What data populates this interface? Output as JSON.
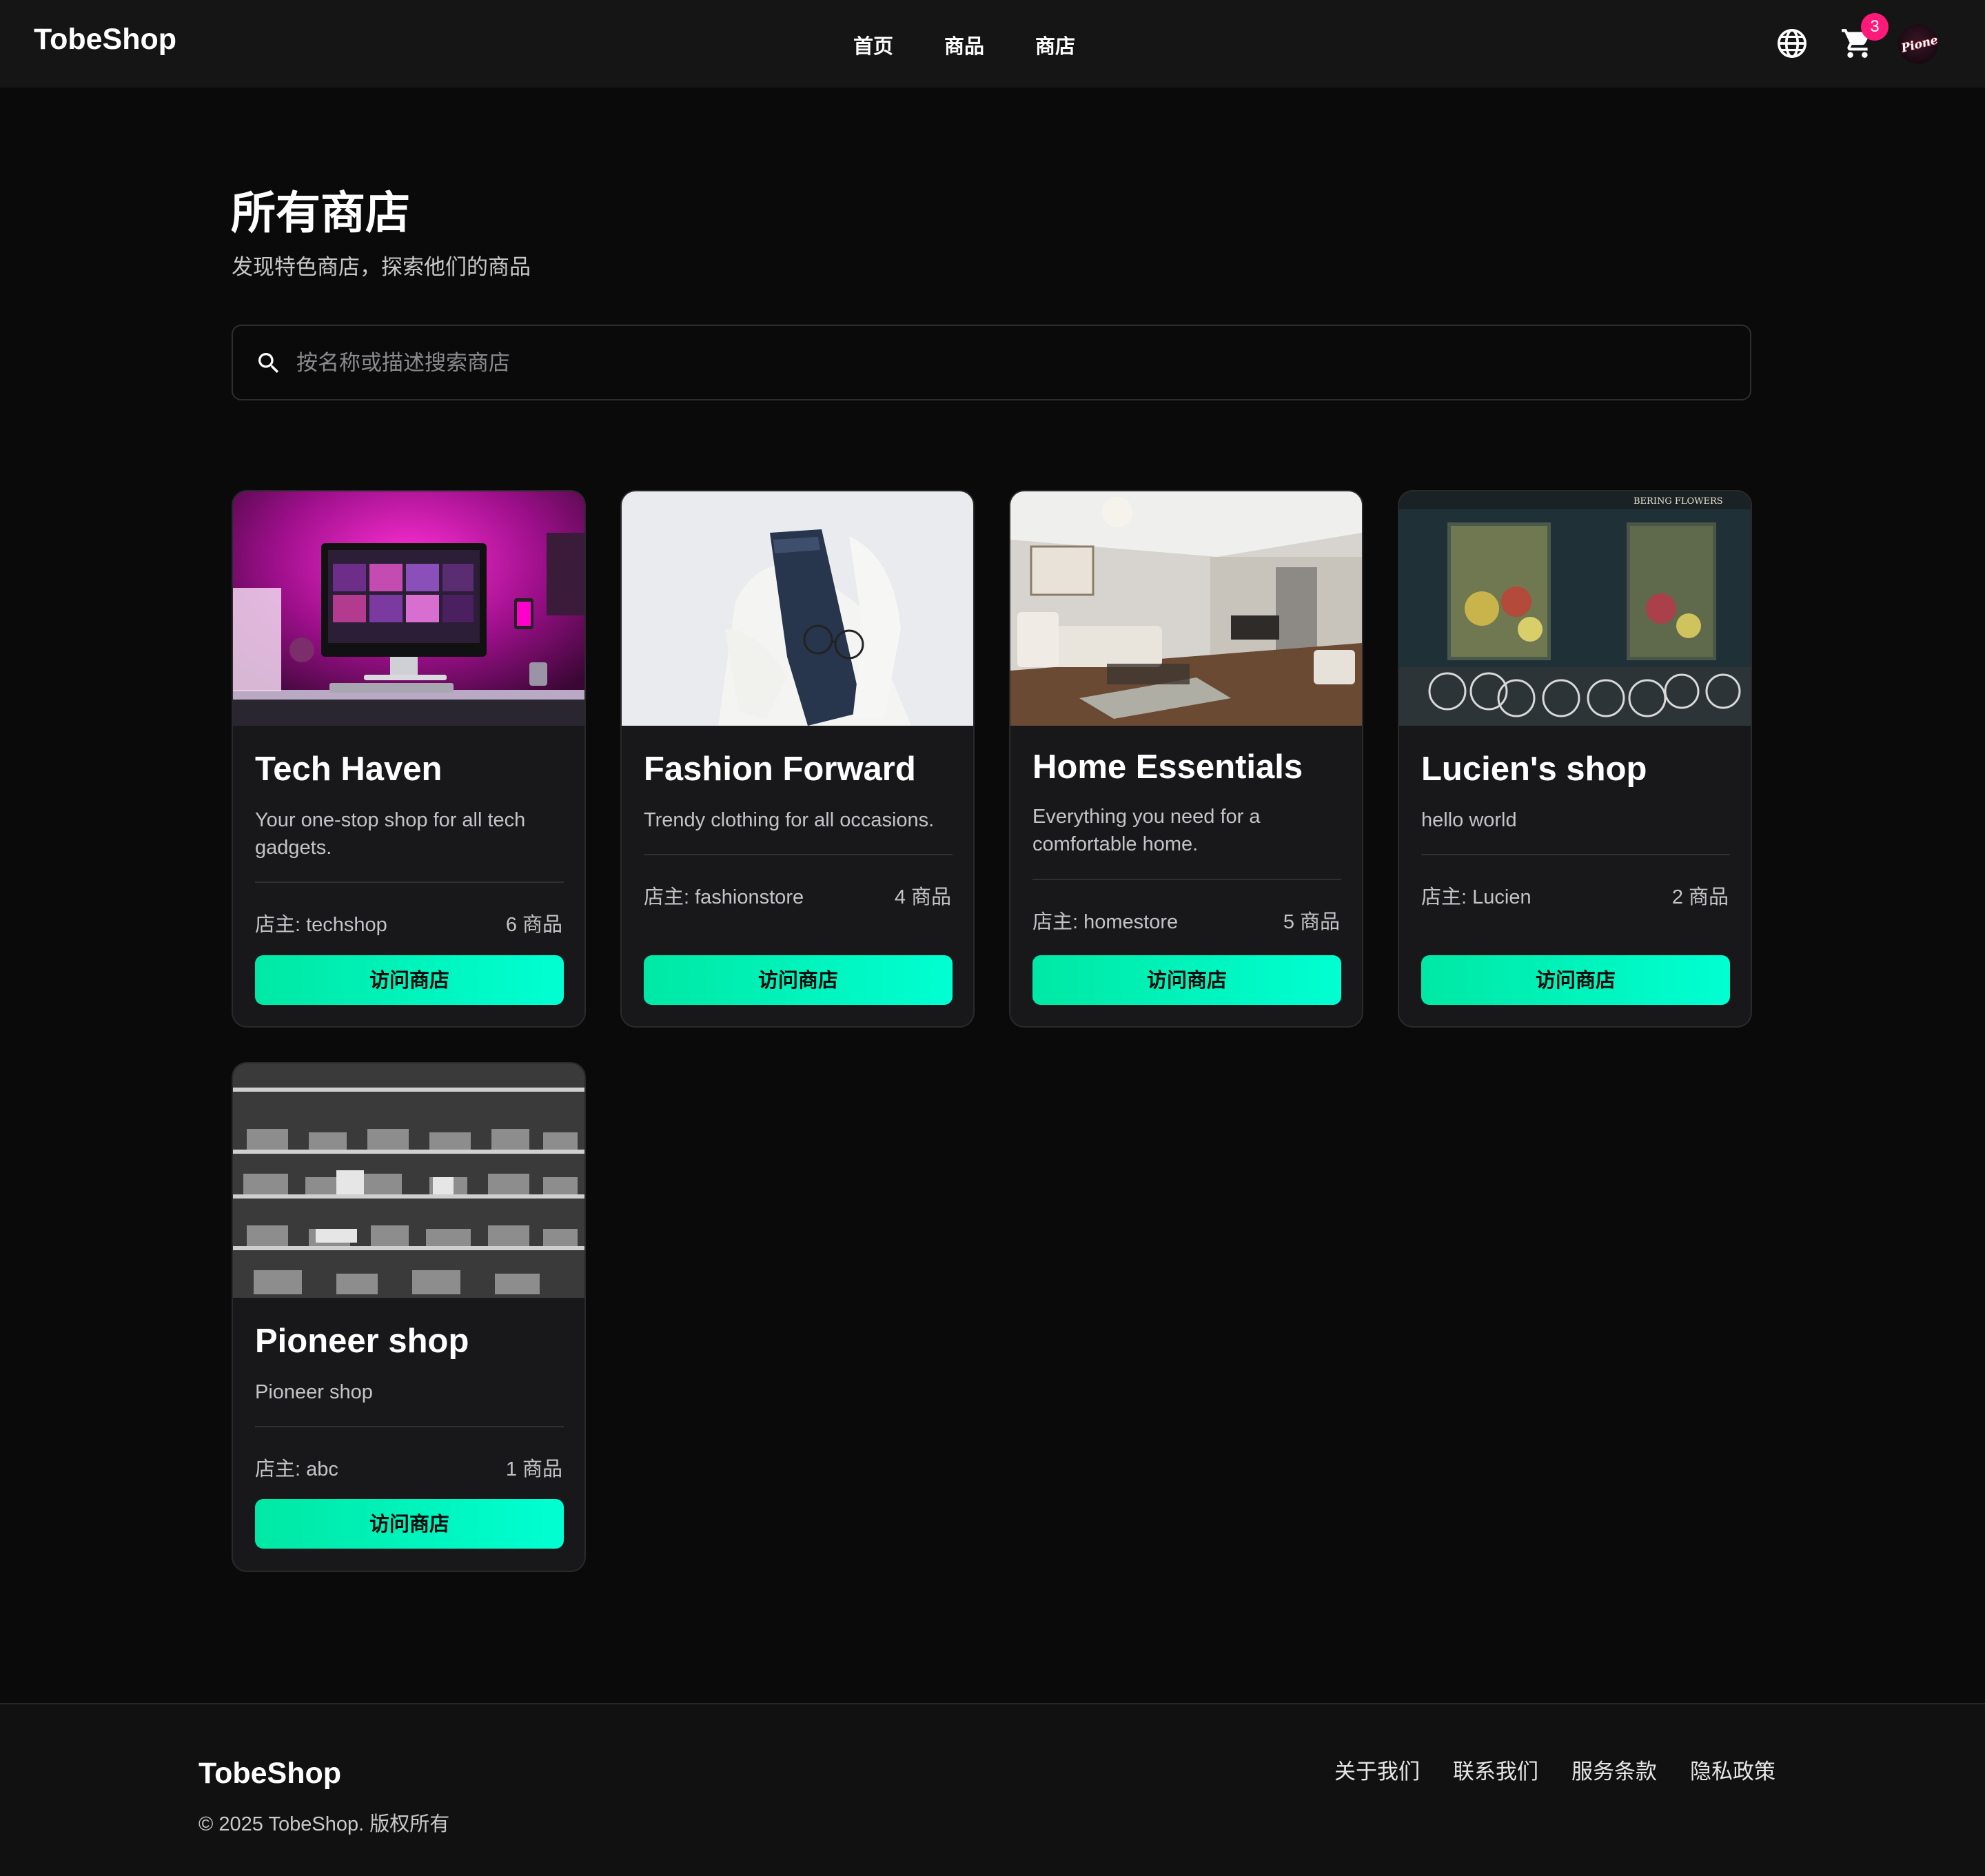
{
  "navbar": {
    "brand": "TobeShop",
    "links": [
      "首页",
      "商品",
      "商店"
    ],
    "cart_count": "3",
    "avatar_text": "Pioneer"
  },
  "header": {
    "title": "所有商店",
    "subtitle": "发现特色商店，探索他们的商品"
  },
  "search": {
    "placeholder": "按名称或描述搜索商店",
    "value": ""
  },
  "shops": [
    {
      "name": "Tech Haven",
      "description": "Your one-stop shop for all tech gadgets.",
      "owner": "店主: techshop",
      "count": "6 商品",
      "button": "访问商店"
    },
    {
      "name": "Fashion Forward",
      "description": "Trendy clothing for all occasions.",
      "owner": "店主: fashionstore",
      "count": "4 商品",
      "button": "访问商店"
    },
    {
      "name": "Home Essentials",
      "description": "Everything you need for a comfortable home.",
      "owner": "店主: homestore",
      "count": "5 商品",
      "button": "访问商店"
    },
    {
      "name": "Lucien's shop",
      "description": "hello world",
      "owner": "店主: Lucien",
      "count": "2 商品",
      "button": "访问商店",
      "image_sign": "BERING FLOWERS"
    },
    {
      "name": "Pioneer shop",
      "description": "Pioneer shop",
      "owner": "店主: abc",
      "count": "1 商品",
      "button": "访问商店"
    }
  ],
  "footer": {
    "brand": "TobeShop",
    "copyright": "© 2025 TobeShop. 版权所有",
    "links": [
      "关于我们",
      "联系我们",
      "服务条款",
      "隐私政策"
    ]
  },
  "colors": {
    "accent_start": "#00e8a4",
    "accent_end": "#00ffd2",
    "badge": "#ff1a7a",
    "background": "#0a0a0b",
    "card": "#18181a"
  },
  "icons": [
    "globe-icon",
    "cart-icon",
    "search-icon"
  ]
}
